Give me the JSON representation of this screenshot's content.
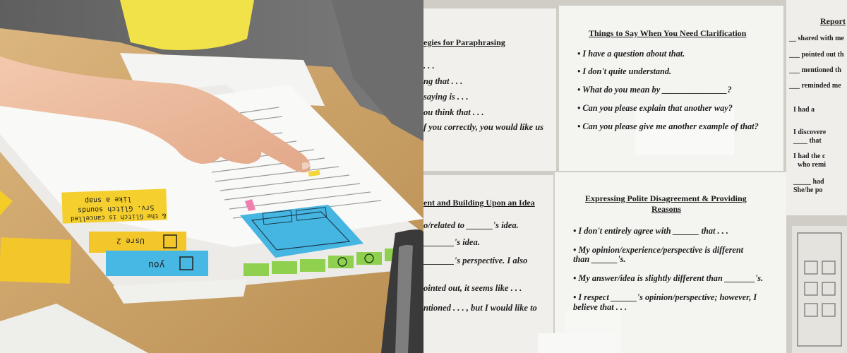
{
  "left_photo": {
    "notes": {
      "yellow_note_line1": "Srv. Glitch sounds",
      "yellow_note_line2": "like a snap",
      "yellow_note_line3": "& the Glitch is cancelled",
      "option_1": "Usre 2",
      "option_2": "you"
    }
  },
  "right_photo": {
    "top_left_sheet": {
      "title": "egies for Paraphrasing",
      "lines": [
        ". . .",
        "ng that . . .",
        "saying is . . .",
        "ou think that . . .",
        "f you correctly, you would like us"
      ]
    },
    "top_center_sheet": {
      "title": "Things to Say When You Need Clarification",
      "bullets": [
        "• I have a question about that.",
        "• I don't quite understand.",
        "• What do you mean by _______________?",
        "• Can you please explain that another way?",
        "• Can you please give me another example of that?"
      ]
    },
    "top_right_sheet": {
      "title": "Report",
      "lines": [
        "__ shared with me",
        "___ pointed out th",
        "___ mentioned th",
        "___ reminded me",
        "I had a",
        "I discovere",
        "____ that",
        "I had the c",
        "who remi",
        "_____ had",
        "She/he po"
      ]
    },
    "bottom_left_sheet": {
      "title": "ent and Building Upon an Idea",
      "lines": [
        "o/related to ______'s idea.",
        "_______'s idea.",
        "_______'s perspective.  I also",
        "ointed out, it seems like . . .",
        "ntioned . . . , but I would like to"
      ]
    },
    "bottom_center_sheet": {
      "title_line1": "Expressing Polite Disagreement & Providing",
      "title_line2": "Reasons",
      "bullets": [
        "• I don't entirely agree with ______ that . . .",
        "• My opinion/experience/perspective is different",
        "   than ______'s.",
        "• My answer/idea is slightly different than _______'s.",
        "• I respect ______'s opinion/perspective; however, I",
        "   believe that . . ."
      ]
    }
  }
}
